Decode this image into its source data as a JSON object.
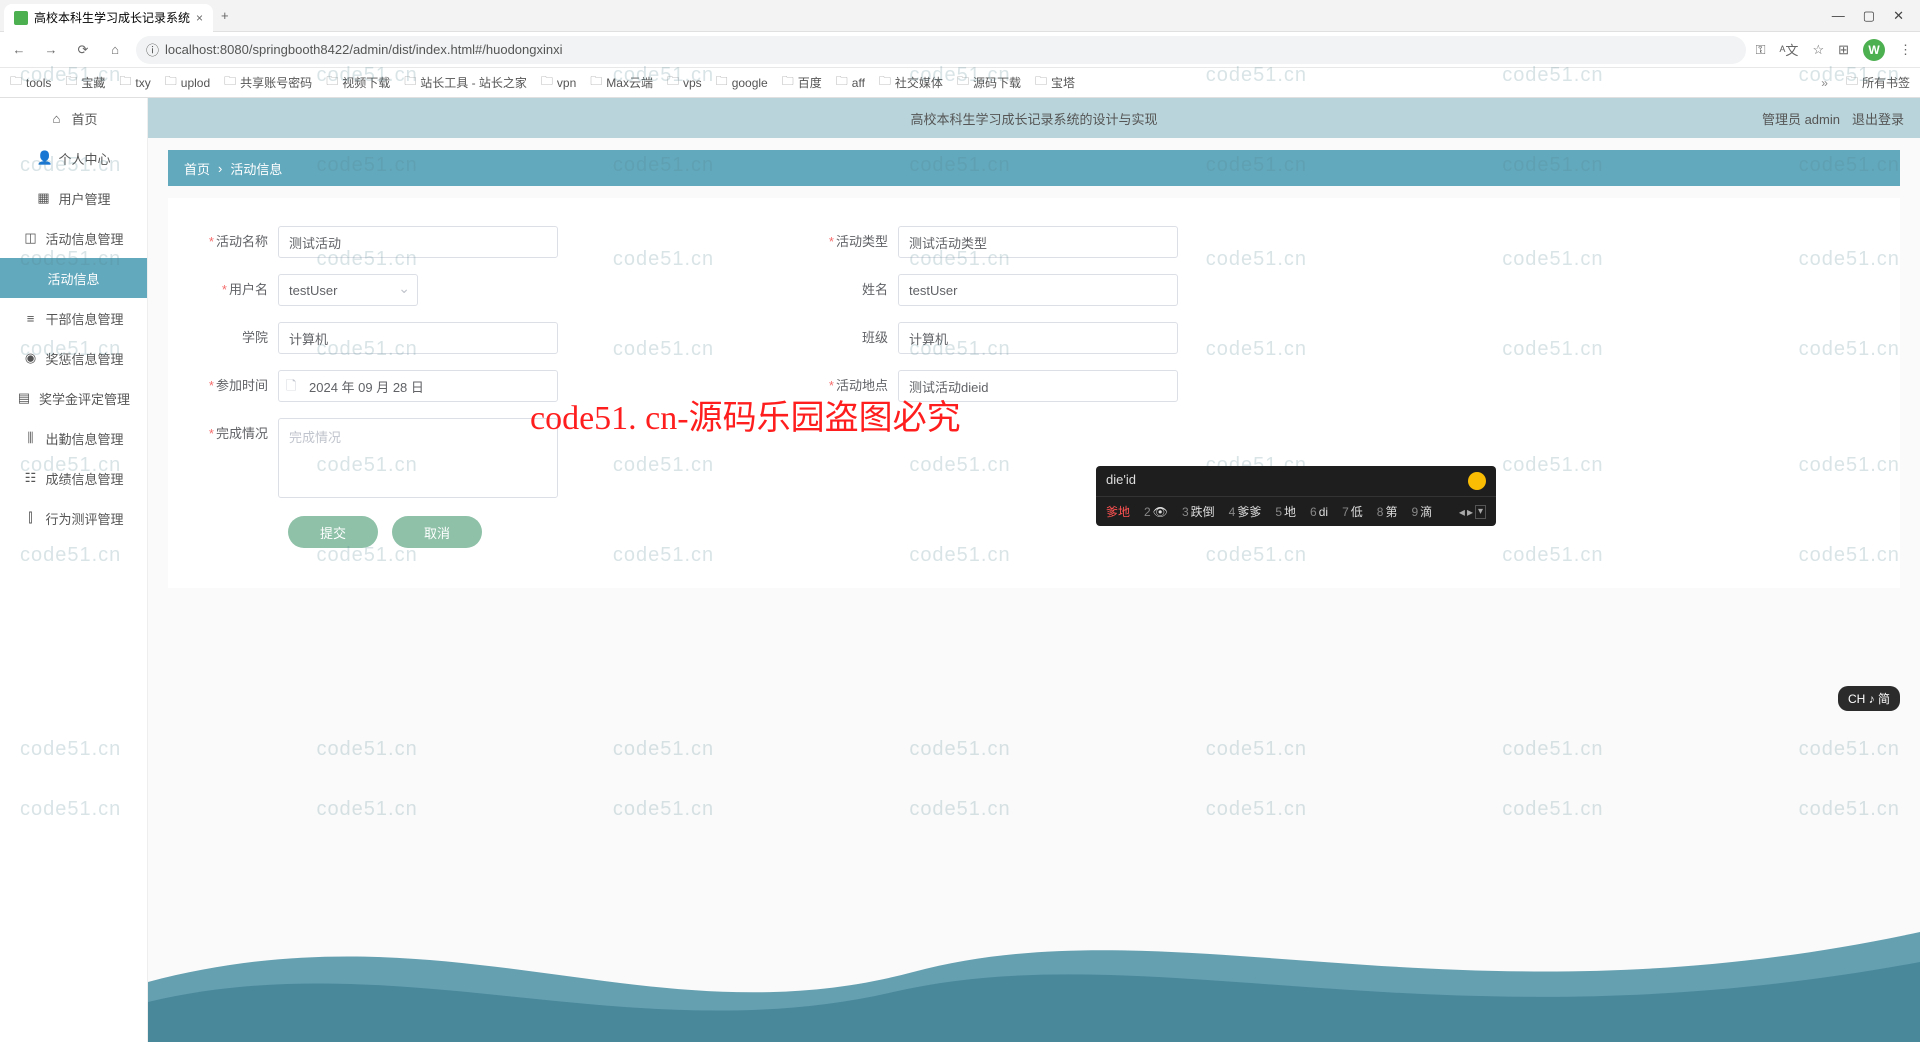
{
  "browser": {
    "tab_title": "高校本科生学习成长记录系统",
    "url": "localhost:8080/springbooth8422/admin/dist/index.html#/huodongxinxi",
    "profile_letter": "W"
  },
  "bookmarks": [
    "tools",
    "宝藏",
    "txy",
    "uplod",
    "共享账号密码",
    "视频下载",
    "站长工具 - 站长之家",
    "vpn",
    "Max云端",
    "vps",
    "google",
    "百度",
    "aff",
    "社交媒体",
    "源码下载",
    "宝塔"
  ],
  "bookmark_right": "所有书签",
  "sidebar": {
    "items": [
      {
        "icon": "⌂",
        "label": "首页"
      },
      {
        "icon": "👤",
        "label": "个人中心"
      },
      {
        "icon": "▦",
        "label": "用户管理"
      },
      {
        "icon": "◫",
        "label": "活动信息管理"
      },
      {
        "icon": "",
        "label": "活动信息",
        "active": true
      },
      {
        "icon": "≡",
        "label": "干部信息管理"
      },
      {
        "icon": "◉",
        "label": "奖惩信息管理"
      },
      {
        "icon": "▤",
        "label": "奖学金评定管理"
      },
      {
        "icon": "⫼",
        "label": "出勤信息管理"
      },
      {
        "icon": "☷",
        "label": "成绩信息管理"
      },
      {
        "icon": "⫿",
        "label": "行为测评管理"
      }
    ]
  },
  "topbar": {
    "title": "高校本科生学习成长记录系统的设计与实现",
    "user": "管理员 admin",
    "logout": "退出登录"
  },
  "breadcrumb": {
    "home": "首页",
    "sep": "›",
    "current": "活动信息"
  },
  "form": {
    "activity_name": {
      "label": "活动名称",
      "value": "测试活动"
    },
    "activity_type": {
      "label": "活动类型",
      "value": "测试活动类型"
    },
    "username": {
      "label": "用户名",
      "value": "testUser"
    },
    "realname": {
      "label": "姓名",
      "value": "testUser"
    },
    "college": {
      "label": "学院",
      "value": "计算机"
    },
    "classname": {
      "label": "班级",
      "value": "计算机"
    },
    "activity_time": {
      "label": "参加时间",
      "value": "2024 年 09 月 28 日"
    },
    "activity_place": {
      "label": "活动地点",
      "value": "测试活动dieid"
    },
    "completion": {
      "label": "完成情况",
      "placeholder": "完成情况",
      "value": ""
    },
    "submit": "提交",
    "cancel": "取消"
  },
  "ime": {
    "input": "die'id",
    "candidates": [
      {
        "n": "",
        "t": "爹地",
        "first": true
      },
      {
        "n": "2",
        "t": "👁"
      },
      {
        "n": "3",
        "t": "跌倒"
      },
      {
        "n": "4",
        "t": "爹爹"
      },
      {
        "n": "5",
        "t": "地"
      },
      {
        "n": "6",
        "t": "di"
      },
      {
        "n": "7",
        "t": "低"
      },
      {
        "n": "8",
        "t": "第"
      },
      {
        "n": "9",
        "t": "滴"
      }
    ]
  },
  "ime_pill": "CH ♪ 简",
  "watermark_text": "code51.cn",
  "big_watermark": "code51. cn-源码乐园盗图必究"
}
